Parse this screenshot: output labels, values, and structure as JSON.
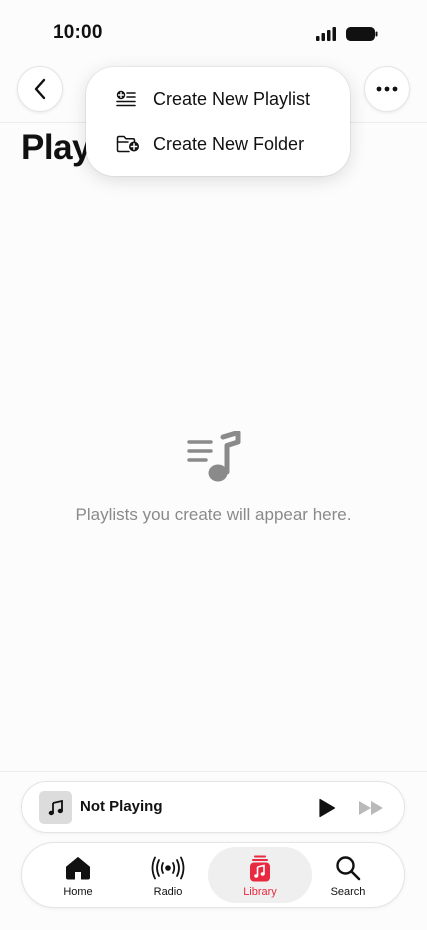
{
  "status_bar": {
    "time": "10:00",
    "icons": [
      "signal-icon",
      "battery-icon"
    ]
  },
  "header": {
    "title": "Playlists",
    "back_icon": "chevron-left-icon",
    "more_icon": "ellipsis-icon"
  },
  "menu": {
    "items": [
      {
        "label": "Create New Playlist",
        "icon": "new-playlist-icon"
      },
      {
        "label": "Create New Folder",
        "icon": "new-folder-icon"
      }
    ]
  },
  "empty_state": {
    "icon": "playlist-music-icon",
    "message": "Playlists you create will appear here."
  },
  "mini_player": {
    "title": "Not Playing",
    "artwork_icon": "music-note-icon",
    "play_icon": "play-icon",
    "forward_icon": "fast-forward-icon"
  },
  "tab_bar": {
    "active": "Library",
    "accent_color": "#e8293f",
    "tabs": [
      {
        "label": "Home",
        "icon": "home-icon"
      },
      {
        "label": "Radio",
        "icon": "radio-icon"
      },
      {
        "label": "Library",
        "icon": "library-icon"
      },
      {
        "label": "Search",
        "icon": "search-icon"
      }
    ]
  }
}
